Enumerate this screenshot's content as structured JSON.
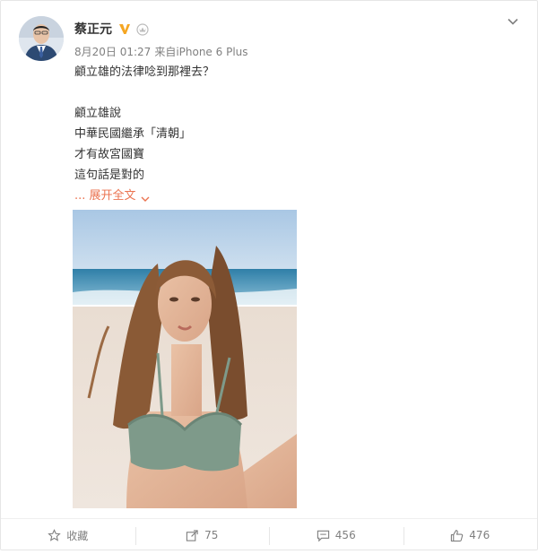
{
  "post": {
    "author": "蔡正元",
    "meta": {
      "date": "8月20日 01:27",
      "source": "来自iPhone 6 Plus"
    },
    "lines": [
      "顧立雄的法律唸到那裡去？",
      "",
      "顧立雄說",
      "中華民國繼承「清朝」",
      "才有故宮國寶",
      "這句話是對的"
    ],
    "expand_label": "... 展开全文"
  },
  "actions": {
    "favorite": "收藏",
    "repost": "75",
    "comment": "456",
    "like": "476"
  },
  "colors": {
    "expand": "#eb7350",
    "verified": "#f5a623",
    "muted": "#808080"
  },
  "icons": {
    "verified": "verified-v-icon",
    "member": "crown-icon",
    "menu": "chevron-down-icon",
    "favorite": "star-icon",
    "repost": "share-arrow-icon",
    "comment": "comment-icon",
    "like": "thumbs-up-icon"
  }
}
